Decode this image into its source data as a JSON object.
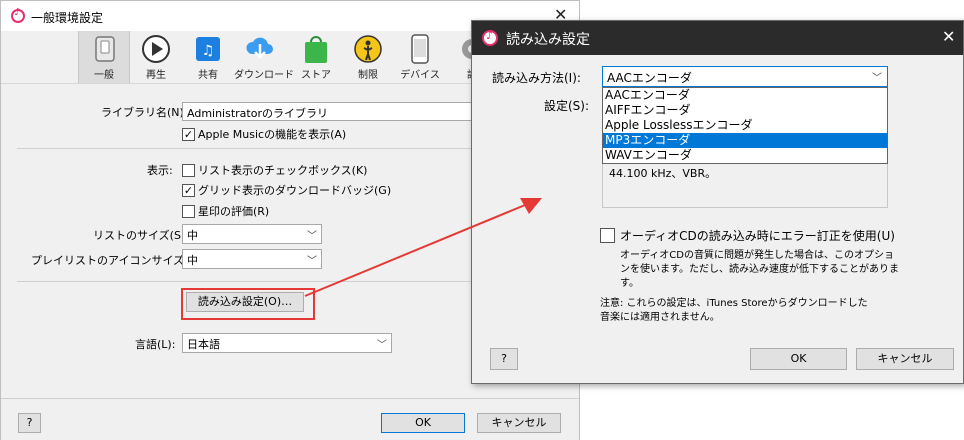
{
  "main_window": {
    "title": "一般環境設定",
    "toolbar": [
      {
        "label": "一般",
        "icon": "switch-icon"
      },
      {
        "label": "再生",
        "icon": "play-icon"
      },
      {
        "label": "共有",
        "icon": "share-icon"
      },
      {
        "label": "ダウンロード",
        "icon": "cloud-download-icon"
      },
      {
        "label": "ストア",
        "icon": "store-bag-icon"
      },
      {
        "label": "制限",
        "icon": "parental-icon"
      },
      {
        "label": "デバイス",
        "icon": "device-icon"
      },
      {
        "label": "詳",
        "icon": "gear-icon"
      }
    ],
    "library_name_label": "ライブラリ名(N):",
    "library_name_value": "Administratorのライブラリ",
    "apple_music_label": "Apple Musicの機能を表示(A)",
    "apple_music_checked": true,
    "display_label": "表示:",
    "checkbox_list": "リスト表示のチェックボックス(K)",
    "checkbox_list_checked": false,
    "grid_badge": "グリッド表示のダウンロードバッジ(G)",
    "grid_badge_checked": true,
    "star_rating": "星印の評価(R)",
    "star_rating_checked": false,
    "list_size_label": "リストのサイズ(S):",
    "list_size_value": "中",
    "playlist_icon_label": "プレイリストのアイコンサイズ(P):",
    "playlist_icon_value": "中",
    "import_settings_button": "読み込み設定(O)…",
    "language_label": "言語(L):",
    "language_value": "日本語",
    "help_button": "?",
    "ok_button": "OK",
    "cancel_button": "キャンセル"
  },
  "import_dialog": {
    "title": "読み込み設定",
    "method_label": "読み込み方法(I):",
    "method_value": "AACエンコーダ",
    "settings_label": "設定(S):",
    "encoder_options": [
      "AACエンコーダ",
      "AIFFエンコーダ",
      "Apple Losslessエンコーダ",
      "MP3エンコーダ",
      "WAVエンコーダ"
    ],
    "highlighted_index": 3,
    "detail_text": "44.100 kHz、VBR。",
    "error_correction_label": "オーディオCDの読み込み時にエラー訂正を使用(U)",
    "error_correction_checked": false,
    "error_note_line1": "オーディオCDの音質に問題が発生した場合は、このオプショ",
    "error_note_line2": "ンを使います。ただし、読み込み速度が低下することがありま",
    "error_note_line3": "す。",
    "store_note_line1": "注意: これらの設定は、iTunes Storeからダウンロードした",
    "store_note_line2": "音楽には適用されません。",
    "help_button": "?",
    "ok_button": "OK",
    "cancel_button": "キャンセル"
  },
  "colors": {
    "highlight": "#0078d7",
    "annotation_red": "#e53935",
    "dialog_titlebar": "#2b2b2b"
  }
}
